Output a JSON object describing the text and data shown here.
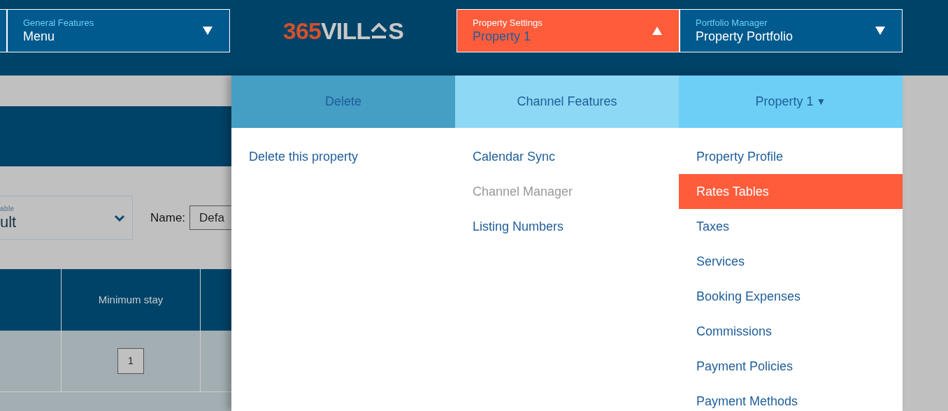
{
  "top_nav": [
    {
      "label": "General Features",
      "value": "Menu",
      "expanded": false
    },
    {
      "label": "Property Settings",
      "value": "Property 1",
      "expanded": true
    },
    {
      "label": "Portfolio Manager",
      "value": "Property Portfolio",
      "expanded": false
    }
  ],
  "logo": {
    "number": "365",
    "word_start": "VILL",
    "word_end": "S"
  },
  "background": {
    "select": {
      "label": "able",
      "value": "ult"
    },
    "name_label": "Name:",
    "name_value": "Defa",
    "table": {
      "columns": [
        "Minimum stay"
      ],
      "rows": [
        {
          "minimum_stay": "1"
        }
      ]
    }
  },
  "menu": {
    "columns": [
      {
        "title": "Delete",
        "color": "#459ec3",
        "items": [
          {
            "label": "Delete this property",
            "disabled": false,
            "selected": false
          }
        ]
      },
      {
        "title": "Channel Features",
        "color": "#8dd8f5",
        "items": [
          {
            "label": "Calendar Sync",
            "disabled": false,
            "selected": false
          },
          {
            "label": "Channel Manager",
            "disabled": true,
            "selected": false
          },
          {
            "label": "Listing Numbers",
            "disabled": false,
            "selected": false
          }
        ]
      },
      {
        "title": "Property 1",
        "caret": "▼",
        "color": "#6dcff6",
        "items": [
          {
            "label": "Property Profile",
            "disabled": false,
            "selected": false
          },
          {
            "label": "Rates Tables",
            "disabled": false,
            "selected": true
          },
          {
            "label": "Taxes",
            "disabled": false,
            "selected": false
          },
          {
            "label": "Services",
            "disabled": false,
            "selected": false
          },
          {
            "label": "Booking Expenses",
            "disabled": false,
            "selected": false
          },
          {
            "label": "Commissions",
            "disabled": false,
            "selected": false
          },
          {
            "label": "Payment Policies",
            "disabled": false,
            "selected": false
          },
          {
            "label": "Payment Methods",
            "disabled": false,
            "selected": false
          }
        ]
      }
    ]
  }
}
